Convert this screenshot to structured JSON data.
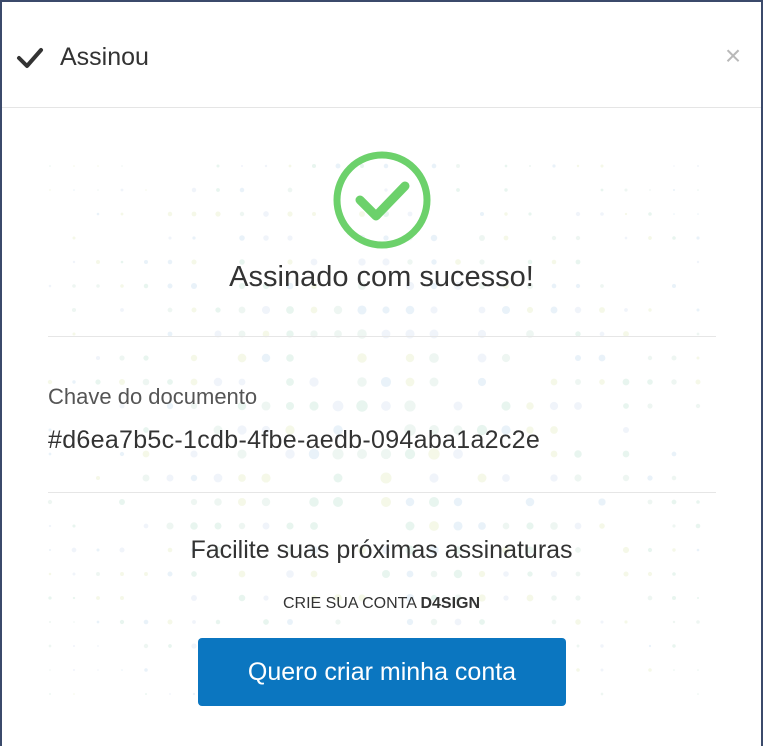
{
  "header": {
    "title": "Assinou",
    "check_icon": "check-icon",
    "close_label": "×"
  },
  "success": {
    "icon": "success-check-circle-icon",
    "title": "Assinado com sucesso!",
    "icon_color": "#6cd16b"
  },
  "document": {
    "key_label": "Chave do documento",
    "key_value": "#d6ea7b5c-1cdb-4fbe-aedb-094aba1a2c2e"
  },
  "promo": {
    "title": "Facilite suas próximas assinaturas",
    "subtitle_prefix": "CRIE SUA CONTA ",
    "subtitle_brand": "D4SIGN",
    "button_label": "Quero criar minha conta",
    "button_color": "#0b76c0"
  }
}
